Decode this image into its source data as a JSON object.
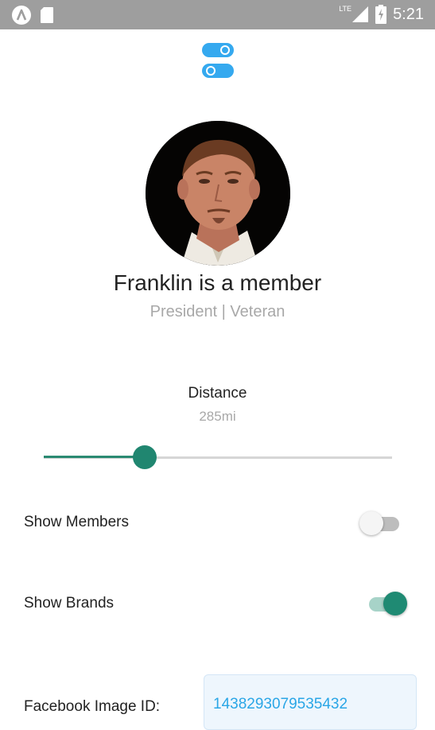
{
  "status_bar": {
    "time": "5:21",
    "network": "LTE",
    "icons": [
      "app-a-icon",
      "sd-card-icon",
      "signal-icon",
      "battery-charging-icon"
    ]
  },
  "app_logo": {
    "icon": "toggle-pills-icon",
    "color": "#35a9ef"
  },
  "profile": {
    "headline": "Franklin is a member",
    "subtitle": "President | Veteran"
  },
  "distance": {
    "label": "Distance",
    "value": "285mi",
    "slider_fraction": 0.29
  },
  "settings": {
    "show_members": {
      "label": "Show Members",
      "enabled": false
    },
    "show_brands": {
      "label": "Show Brands",
      "enabled": true
    }
  },
  "facebook": {
    "label": "Facebook Image ID:",
    "value": "1438293079535432"
  },
  "colors": {
    "accent": "#208670",
    "link": "#2aa6e6",
    "status_bar": "#9e9e9e"
  }
}
